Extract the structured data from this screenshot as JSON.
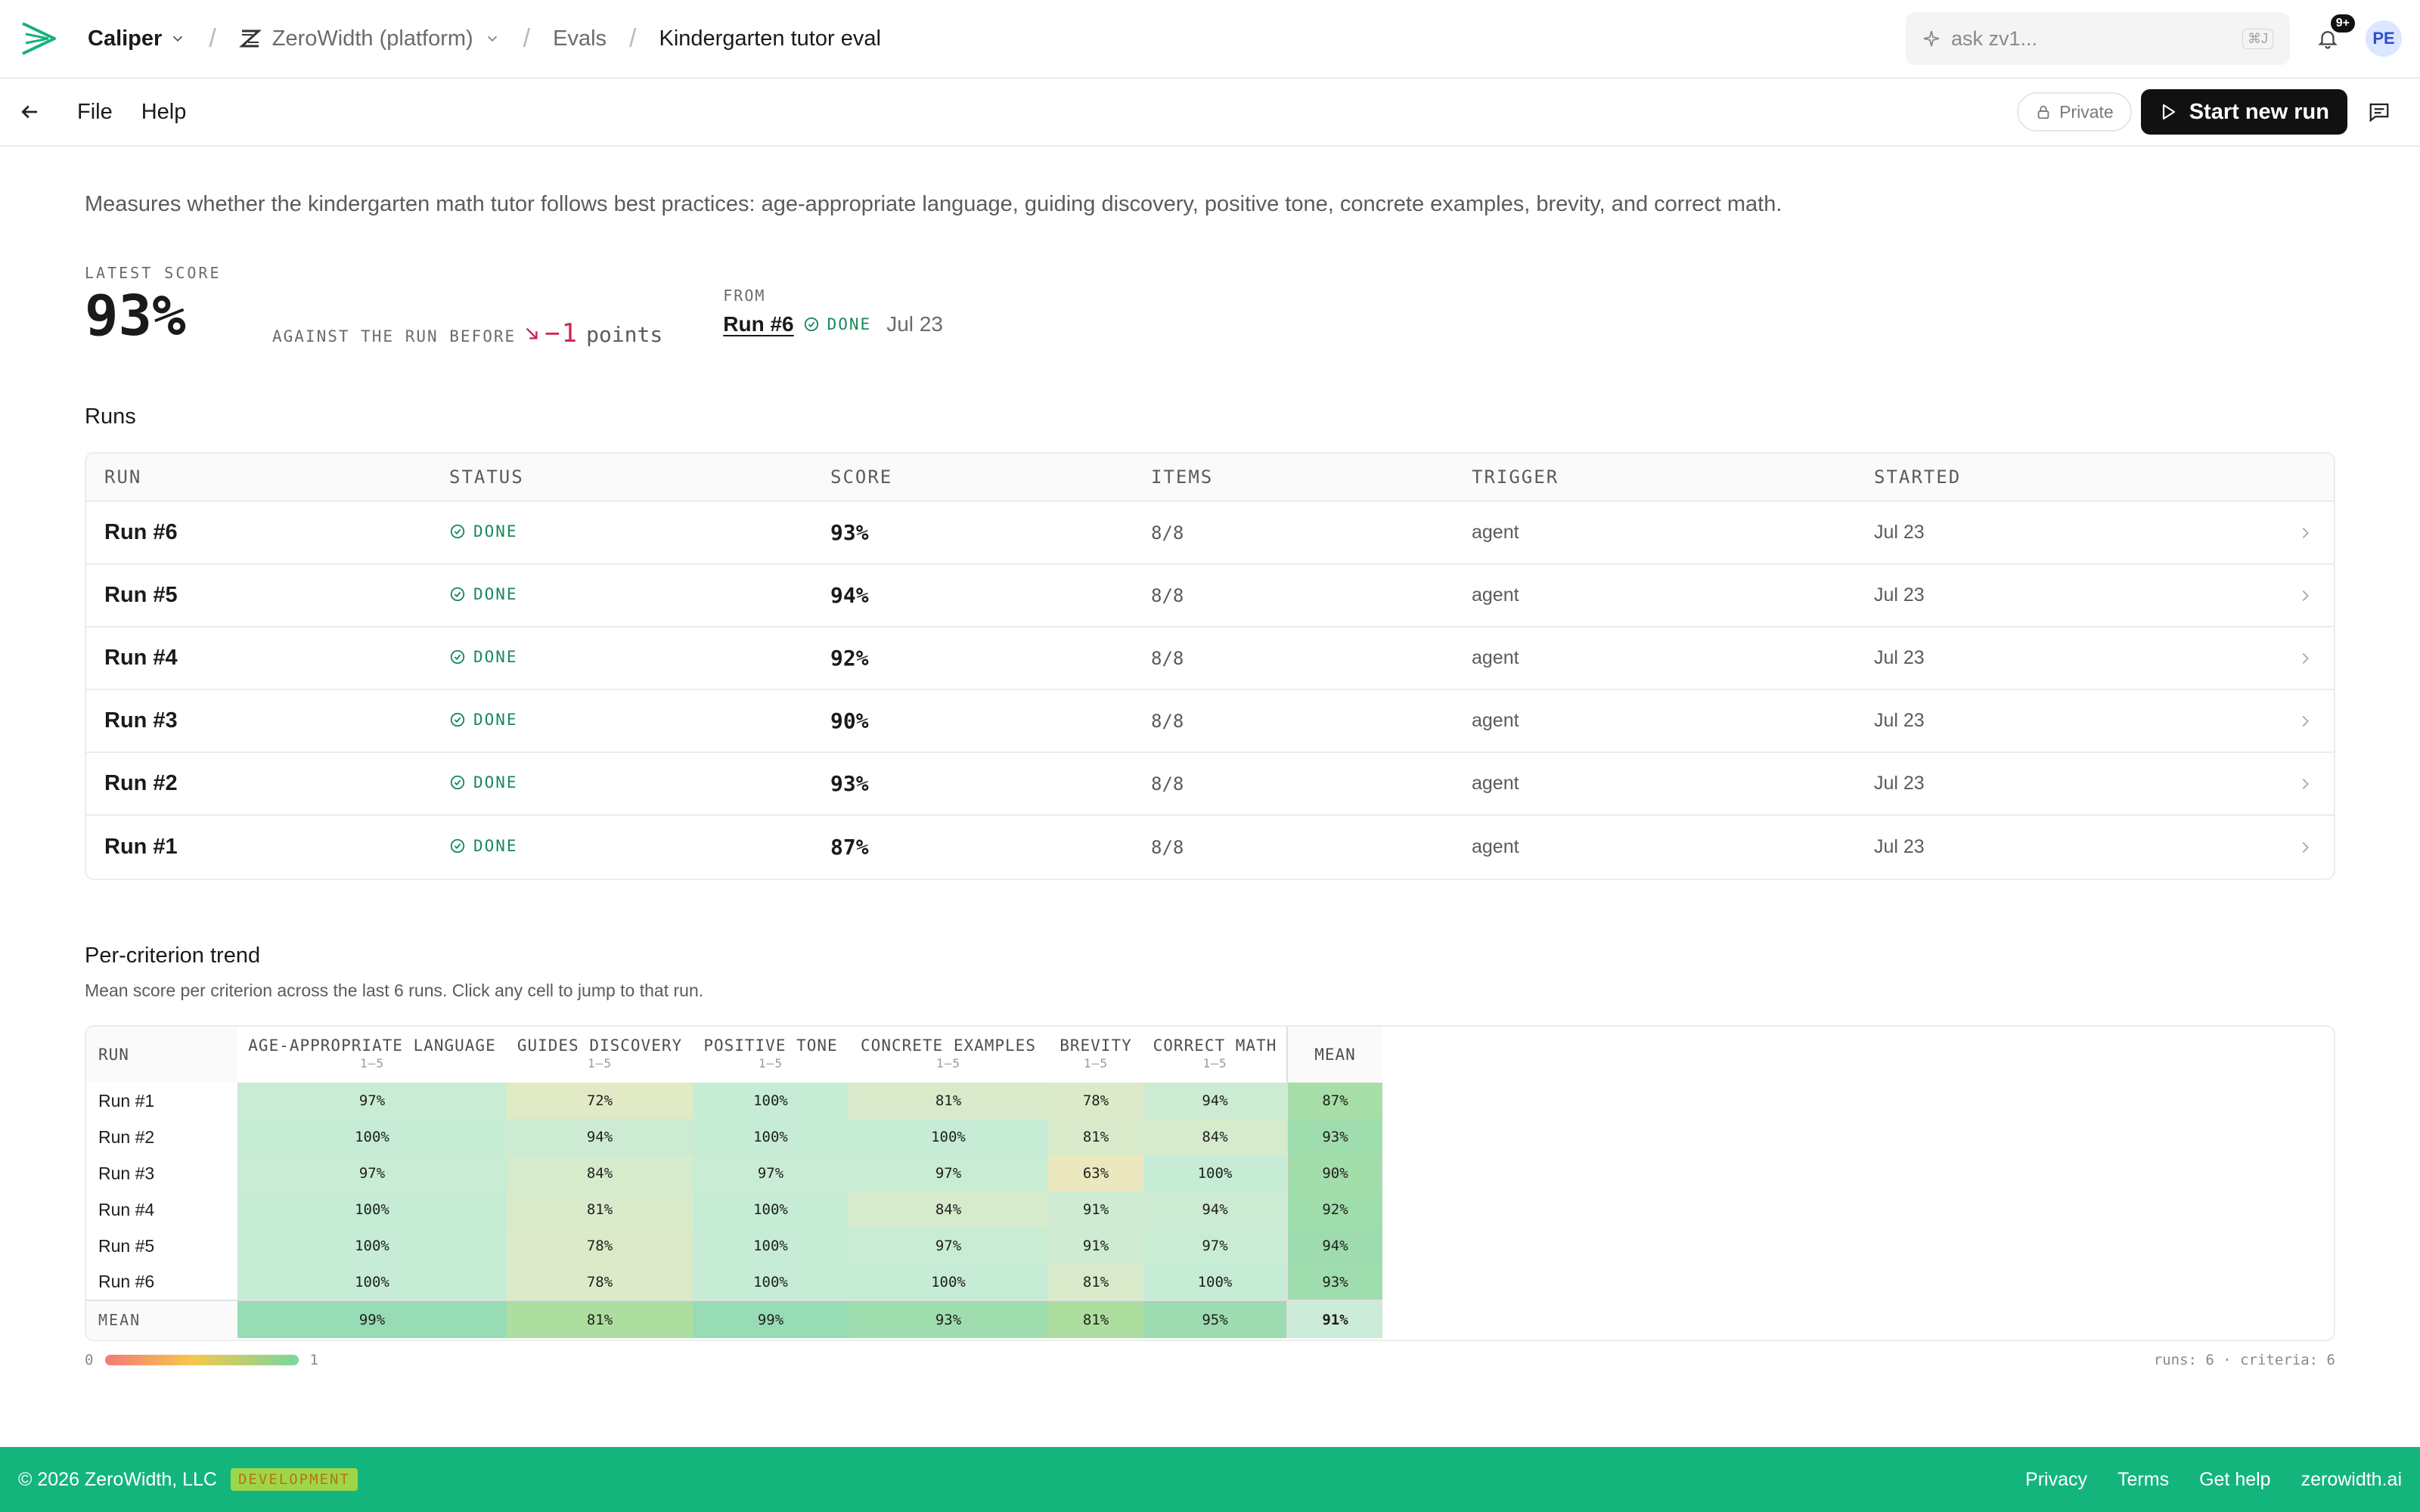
{
  "topbar": {
    "app_name": "Caliper",
    "org_name": "ZeroWidth (platform)",
    "section": "Evals",
    "current": "Kindergarten tutor eval",
    "search_placeholder": "ask zv1...",
    "search_shortcut": "⌘J",
    "notifications_badge": "9+",
    "avatar_initials": "PE"
  },
  "menubar": {
    "file_label": "File",
    "help_label": "Help",
    "private_label": "Private",
    "start_label": "Start new run"
  },
  "description": "Measures whether the kindergarten math tutor follows best practices: age-appropriate language, guiding discovery, positive tone, concrete examples, brevity, and correct math.",
  "score": {
    "latest_label": "LATEST SCORE",
    "latest_value": "93%",
    "against_label": "AGAINST THE RUN BEFORE",
    "delta_value": "−1",
    "delta_unit": "points",
    "from_label": "FROM",
    "from_run": "Run #6",
    "from_status": "DONE",
    "from_date": "Jul 23"
  },
  "runs": {
    "title": "Runs",
    "headers": {
      "run": "RUN",
      "status": "STATUS",
      "score": "SCORE",
      "items": "ITEMS",
      "trigger": "TRIGGER",
      "started": "STARTED"
    },
    "rows": [
      {
        "run": "Run #6",
        "status": "DONE",
        "score": "93%",
        "items": "8/8",
        "trigger": "agent",
        "started": "Jul 23"
      },
      {
        "run": "Run #5",
        "status": "DONE",
        "score": "94%",
        "items": "8/8",
        "trigger": "agent",
        "started": "Jul 23"
      },
      {
        "run": "Run #4",
        "status": "DONE",
        "score": "92%",
        "items": "8/8",
        "trigger": "agent",
        "started": "Jul 23"
      },
      {
        "run": "Run #3",
        "status": "DONE",
        "score": "90%",
        "items": "8/8",
        "trigger": "agent",
        "started": "Jul 23"
      },
      {
        "run": "Run #2",
        "status": "DONE",
        "score": "93%",
        "items": "8/8",
        "trigger": "agent",
        "started": "Jul 23"
      },
      {
        "run": "Run #1",
        "status": "DONE",
        "score": "87%",
        "items": "8/8",
        "trigger": "agent",
        "started": "Jul 23"
      }
    ]
  },
  "trend": {
    "title": "Per-criterion trend",
    "subtitle": "Mean score per criterion across the last 6 runs. Click any cell to jump to that run.",
    "run_header": "RUN",
    "mean_header": "MEAN",
    "criteria": [
      {
        "name": "AGE-APPROPRIATE LANGUAGE",
        "scale": "1–5"
      },
      {
        "name": "GUIDES DISCOVERY",
        "scale": "1–5"
      },
      {
        "name": "POSITIVE TONE",
        "scale": "1–5"
      },
      {
        "name": "CONCRETE EXAMPLES",
        "scale": "1–5"
      },
      {
        "name": "BREVITY",
        "scale": "1–5"
      },
      {
        "name": "CORRECT MATH",
        "scale": "1–5"
      }
    ],
    "rows": [
      {
        "run": "Run #1",
        "cells": [
          "97%",
          "72%",
          "100%",
          "81%",
          "78%",
          "94%"
        ],
        "mean": "87%"
      },
      {
        "run": "Run #2",
        "cells": [
          "100%",
          "94%",
          "100%",
          "100%",
          "81%",
          "84%"
        ],
        "mean": "93%"
      },
      {
        "run": "Run #3",
        "cells": [
          "97%",
          "84%",
          "97%",
          "97%",
          "63%",
          "100%"
        ],
        "mean": "90%"
      },
      {
        "run": "Run #4",
        "cells": [
          "100%",
          "81%",
          "100%",
          "84%",
          "91%",
          "94%"
        ],
        "mean": "92%"
      },
      {
        "run": "Run #5",
        "cells": [
          "100%",
          "78%",
          "100%",
          "97%",
          "91%",
          "97%"
        ],
        "mean": "94%"
      },
      {
        "run": "Run #6",
        "cells": [
          "100%",
          "78%",
          "100%",
          "100%",
          "81%",
          "100%"
        ],
        "mean": "93%"
      }
    ],
    "mean_row": {
      "label": "MEAN",
      "cells": [
        "99%",
        "81%",
        "99%",
        "93%",
        "81%",
        "95%"
      ],
      "overall": "91%"
    },
    "legend_min": "0",
    "legend_max": "1",
    "summary": "runs: 6 · criteria: 6"
  },
  "footer": {
    "copyright": "© 2026 ZeroWidth, LLC",
    "env_badge": "DEVELOPMENT",
    "links": [
      "Privacy",
      "Terms",
      "Get help",
      "zerowidth.ai"
    ]
  }
}
